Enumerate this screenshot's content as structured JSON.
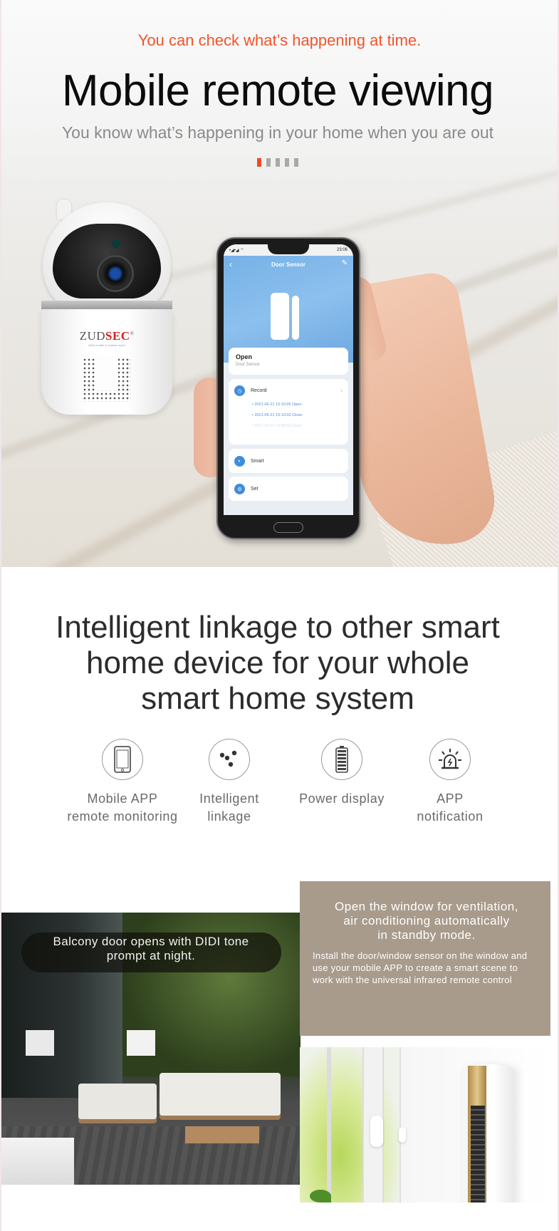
{
  "hero": {
    "eyebrow": "You can check what’s happening at time.",
    "title": "Mobile remote viewing",
    "subtitle": "You know what’s happening in your home when you are out",
    "carousel": {
      "total_slides": 5,
      "active_index": 0,
      "active_color": "#f24a22",
      "inactive_color": "#a9a9a9"
    },
    "camera": {
      "brand_prefix": "ZUD",
      "brand_suffix": "SEC",
      "registered_mark": "®",
      "tagline": "Build a safer & smarter world"
    },
    "phone": {
      "status_signal": "•◢•◢ ⌔",
      "status_time": "23:06",
      "screen_title": "Door Sensor",
      "back_icon": "chevron-left-icon",
      "edit_icon": "pencil-icon",
      "state_label": "Open",
      "device_label": "Door Sensor",
      "record_label": "Record",
      "records": [
        "2021-06-21 15:10:05 Open",
        "2021-06-21 15:10:02 Close",
        "2021-06-21 15:08:43 Open"
      ],
      "smart_label": "Smart",
      "set_label": "Set"
    }
  },
  "linkage": {
    "title": "Intelligent linkage to other smart home device for your whole smart home system",
    "features": [
      {
        "icon": "smartphone-icon",
        "label_line1": "Mobile APP",
        "label_line2": "remote monitoring"
      },
      {
        "icon": "linkage-dots-icon",
        "label_line1": "Intelligent",
        "label_line2": "linkage"
      },
      {
        "icon": "battery-icon",
        "label_line1": "Power display",
        "label_line2": ""
      },
      {
        "icon": "alarm-light-icon",
        "label_line1": "APP",
        "label_line2": "notification"
      }
    ]
  },
  "scenes": {
    "balcony_caption_line1": "Balcony door opens with DIDI tone",
    "balcony_caption_line2": "prompt at night.",
    "window_heading_line1": "Open the window for ventilation,",
    "window_heading_line2": "air conditioning automatically",
    "window_heading_line3": "in standby mode.",
    "window_body": "Install the door/window sensor on the window and use your mobile APP to create a smart scene to work with the universal infrared remote control",
    "box_color": "#a89b8b"
  }
}
